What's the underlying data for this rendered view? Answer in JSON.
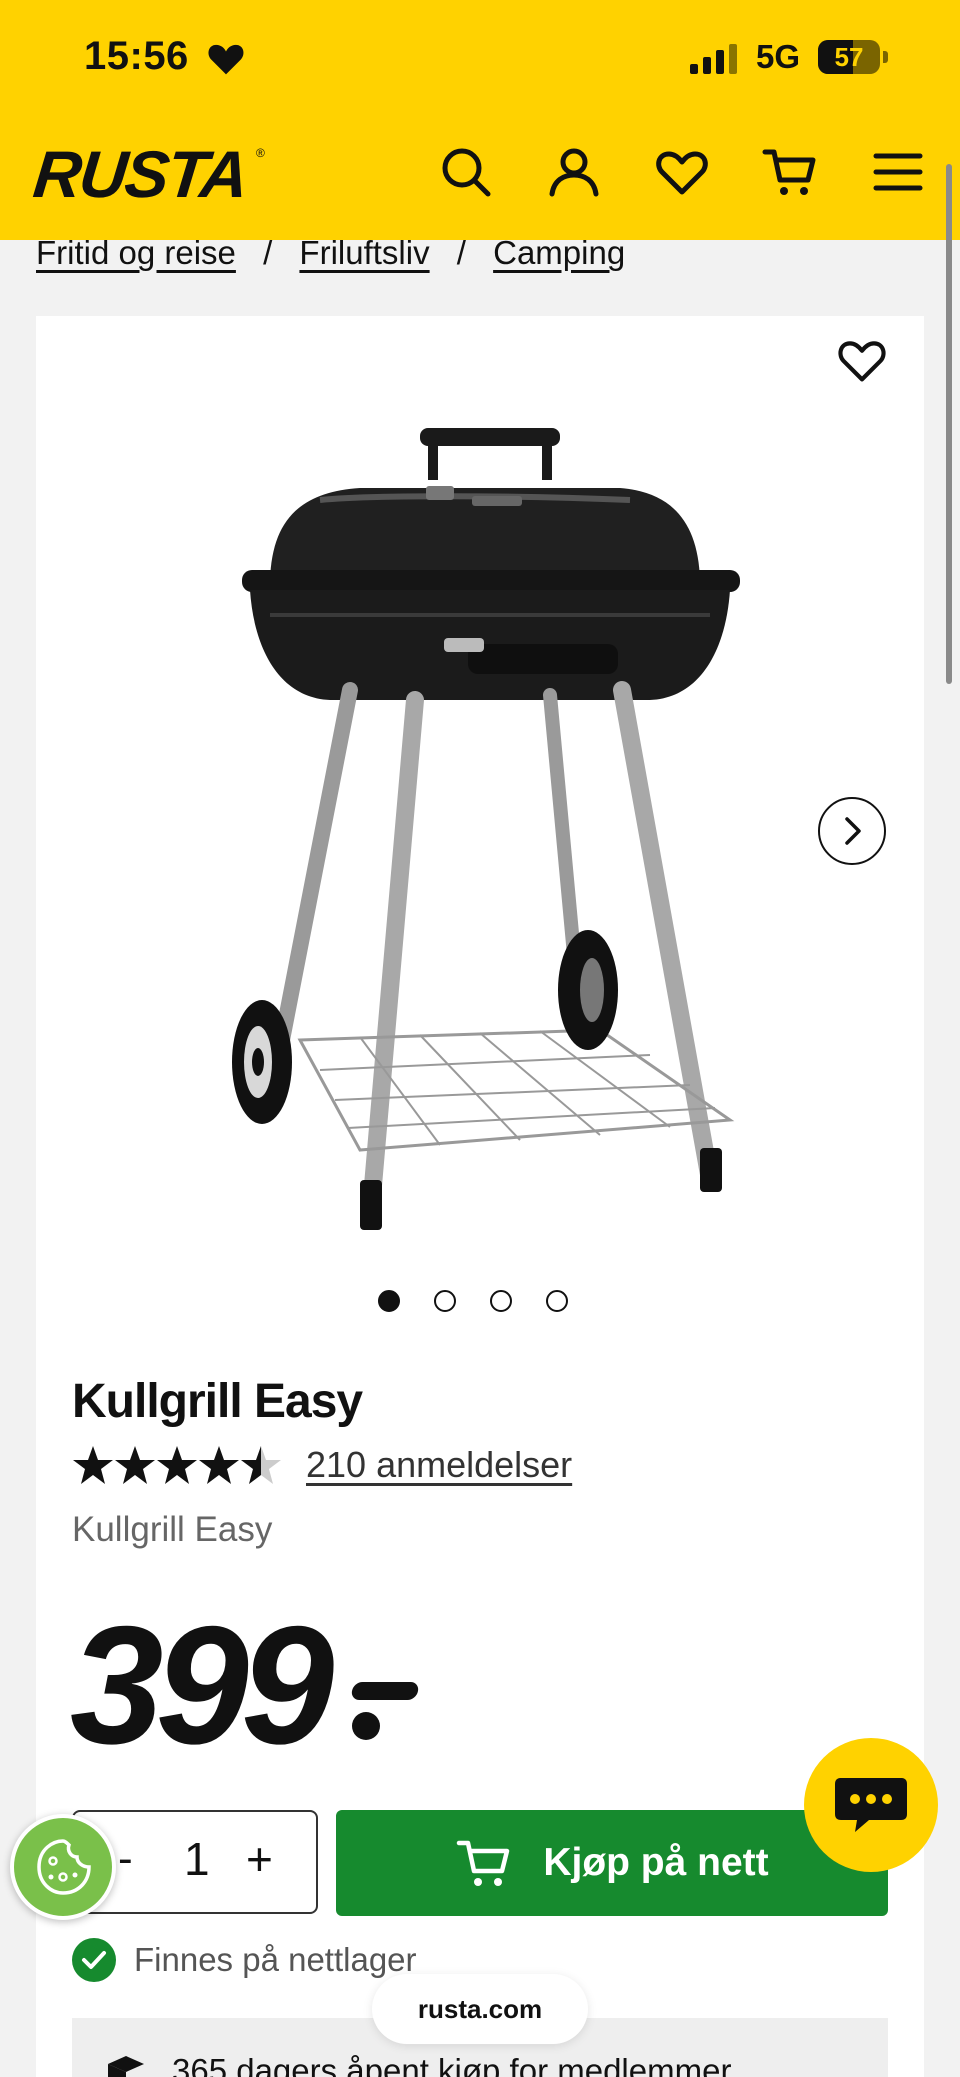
{
  "status_bar": {
    "time": "15:56",
    "network": "5G",
    "battery": "57"
  },
  "header": {
    "logo": "RUSTA"
  },
  "breadcrumb": {
    "items": [
      "Fritid og reise",
      "Friluftsliv",
      "Camping"
    ],
    "separator": "/"
  },
  "product": {
    "title": "Kullgrill Easy",
    "rating": 4.5,
    "reviews": "210 anmeldelser",
    "subtitle": "Kullgrill Easy",
    "price": "399",
    "image_count": 4,
    "active_image": 1
  },
  "purchase": {
    "quantity_minus": "-",
    "quantity": "1",
    "quantity_plus": "+",
    "buy_label": "Kjøp på nett",
    "stock_text": "Finnes på nettlager"
  },
  "promo": {
    "text": "365 dagers åpent kjøp for medlemmer"
  },
  "browser": {
    "url": "rusta.com"
  },
  "colors": {
    "brand_yellow": "#ffd200",
    "buy_green": "#168a2e",
    "text": "#111111"
  }
}
